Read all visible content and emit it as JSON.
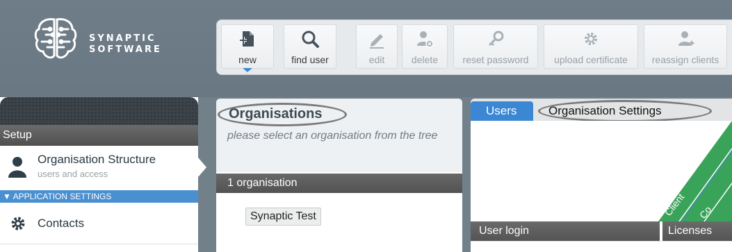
{
  "brand": {
    "line1": "SYNAPTIC",
    "line2": "SOFTWARE"
  },
  "toolbar": {
    "buttons": [
      {
        "label": "new",
        "icon": "new-document-icon",
        "enabled": true,
        "has_menu": true
      },
      {
        "label": "find user",
        "icon": "search-icon",
        "enabled": true
      },
      {
        "label": "edit",
        "icon": "pencil-icon",
        "enabled": false
      },
      {
        "label": "delete",
        "icon": "delete-user-icon",
        "enabled": false
      },
      {
        "label": "reset password",
        "icon": "key-icon",
        "enabled": false
      },
      {
        "label": "upload certificate",
        "icon": "gear-icon",
        "enabled": false
      },
      {
        "label": "reassign clients",
        "icon": "reassign-user-icon",
        "enabled": false
      }
    ]
  },
  "sidebar": {
    "section": "Setup",
    "selected_item": {
      "title": "Organisation Structure",
      "subtitle": "users and access",
      "icon": "person-icon"
    },
    "group_header": "APPLICATION SETTINGS",
    "items": [
      {
        "label": "Contacts",
        "icon": "gear-icon"
      }
    ]
  },
  "organisations": {
    "title": "Organisations",
    "hint": "please select an organisation from the tree",
    "count_label": "1 organisation",
    "tree": [
      "Synaptic Test"
    ]
  },
  "detail": {
    "tabs": [
      {
        "label": "Users",
        "active": true
      },
      {
        "label": "Organisation Settings",
        "active": false
      }
    ],
    "diagonal_labels": [
      "Client",
      "Co"
    ],
    "columns": [
      "User login",
      "Licenses"
    ]
  },
  "colors": {
    "accent": "#3b87d3",
    "header_dark": "#555555",
    "diagonal_green": "#3aa35a"
  }
}
